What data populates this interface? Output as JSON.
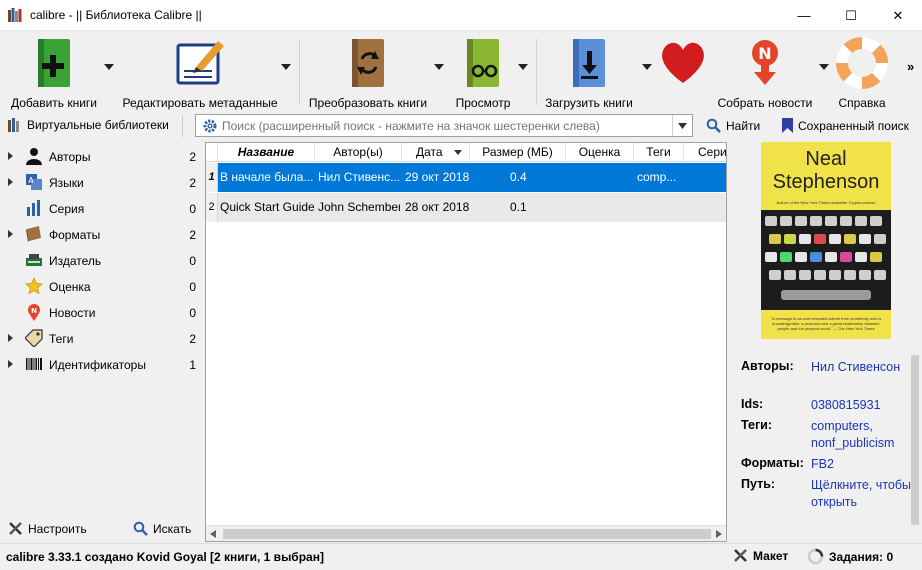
{
  "window": {
    "title": "calibre - || Библиотека Calibre ||",
    "minimize": "—",
    "maximize": "☐",
    "close": "✕"
  },
  "toolbar": {
    "add_books": "Добавить книги",
    "edit_metadata": "Редактировать метаданные",
    "convert_books": "Преобразовать книги",
    "view": "Просмотр",
    "send_to_device": "Загрузить книги",
    "donate_icon": "heart-icon",
    "fetch_news": "Собрать новости",
    "help": "Справка",
    "more": "»"
  },
  "searchbar": {
    "virtual_libraries": "Виртуальные библиотеки",
    "placeholder": "Поиск (расширенный поиск - нажмите на значок шестеренки слева)",
    "find": "Найти",
    "saved_search": "Сохраненный поиск"
  },
  "tag_browser": {
    "items": [
      {
        "label": "Авторы",
        "count": "2",
        "expandable": true,
        "icon": "user-icon"
      },
      {
        "label": "Языки",
        "count": "2",
        "expandable": true,
        "icon": "languages-icon"
      },
      {
        "label": "Серия",
        "count": "0",
        "expandable": false,
        "icon": "series-icon"
      },
      {
        "label": "Форматы",
        "count": "2",
        "expandable": true,
        "icon": "book-icon"
      },
      {
        "label": "Издатель",
        "count": "0",
        "expandable": false,
        "icon": "publisher-icon"
      },
      {
        "label": "Оценка",
        "count": "0",
        "expandable": false,
        "icon": "star-icon"
      },
      {
        "label": "Новости",
        "count": "0",
        "expandable": false,
        "icon": "news-icon"
      },
      {
        "label": "Теги",
        "count": "2",
        "expandable": true,
        "icon": "tag-icon"
      },
      {
        "label": "Идентификаторы",
        "count": "1",
        "expandable": true,
        "icon": "barcode-icon"
      }
    ],
    "configure": "Настроить",
    "find": "Искать"
  },
  "book_list": {
    "columns": [
      "Название",
      "Автор(ы)",
      "Дата",
      "Размер (МБ)",
      "Оценка",
      "Теги",
      "Сери"
    ],
    "rows": [
      {
        "num": "1",
        "title": "В начале была...",
        "author": "Нил Стивенс...",
        "date": "29 окт 2018",
        "size": "0.4",
        "rating": "",
        "tags": "comp...",
        "series": ""
      },
      {
        "num": "2",
        "title": "Quick Start Guide",
        "author": "John Schember",
        "date": "28 окт 2018",
        "size": "0.1",
        "rating": "",
        "tags": "",
        "series": ""
      }
    ]
  },
  "details": {
    "cover_author_first": "Neal",
    "cover_author_last": "Stephenson",
    "cover_tagline": "Author of the New York Times bestseller Cryptonomicon",
    "cover_quote": "\"A message to an over-invested culture from somebody who is knowledgeable: a profound and a great relationship between people and the physical world.\" —The New York Times",
    "fields": [
      {
        "key": "Авторы:",
        "value": "Нил Стивенсон"
      },
      {
        "key": "Ids:",
        "value": "0380815931"
      },
      {
        "key": "Теги:",
        "value": "computers, nonf_publicism"
      },
      {
        "key": "Форматы:",
        "value": "FB2"
      },
      {
        "key": "Путь:",
        "value": "Щёлкните, чтобы открыть"
      }
    ]
  },
  "statusbar": {
    "version": "calibre 3.33.1 создано Kovid Goyal",
    "selection": "[2 книги, 1 выбран]",
    "layout": "Макет",
    "jobs": "Задания: 0"
  },
  "colors": {
    "selection": "#0078d7",
    "link": "#1a37b3"
  }
}
